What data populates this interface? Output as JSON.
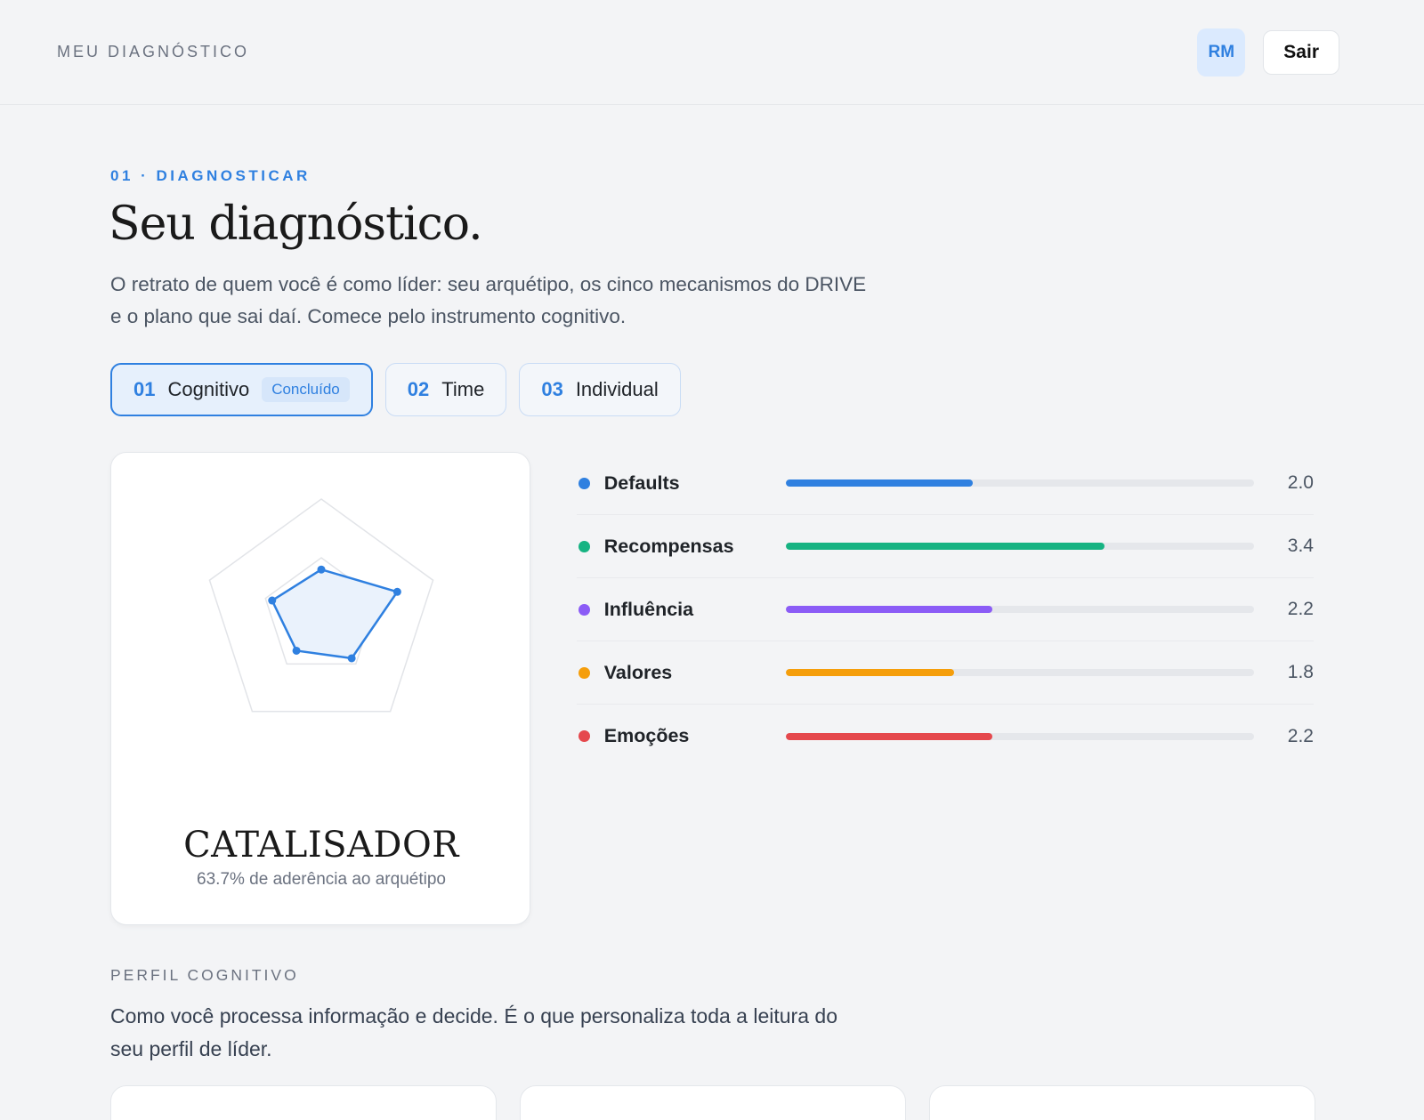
{
  "header": {
    "brand": "MEU DIAGNÓSTICO",
    "avatar_initials": "RM",
    "logout_label": "Sair"
  },
  "hero": {
    "eyebrow": "01 · DIAGNOSTICAR",
    "title": "Seu diagnóstico.",
    "intro": "O retrato de quem você é como líder: seu arquétipo, os cinco mecanismos do DRIVE e o plano que sai daí. Comece pelo instrumento cognitivo."
  },
  "tabs": [
    {
      "num": "01",
      "label": "Cognitivo",
      "badge": "Concluído",
      "active": true
    },
    {
      "num": "02",
      "label": "Time"
    },
    {
      "num": "03",
      "label": "Individual"
    }
  ],
  "archetype": {
    "name": "CATALISADOR",
    "adherence": "63.7% de aderência ao arquétipo"
  },
  "metrics_max": 5,
  "metrics": [
    {
      "label": "Defaults",
      "value": 2.0,
      "display": "2.0",
      "color": "#2f80e0"
    },
    {
      "label": "Recompensas",
      "value": 3.4,
      "display": "3.4",
      "color": "#16b382"
    },
    {
      "label": "Influência",
      "value": 2.2,
      "display": "2.2",
      "color": "#8b5cf6"
    },
    {
      "label": "Valores",
      "value": 1.8,
      "display": "1.8",
      "color": "#f59e0b"
    },
    {
      "label": "Emoções",
      "value": 2.2,
      "display": "2.2",
      "color": "#e5484d"
    }
  ],
  "profile": {
    "label": "PERFIL COGNITIVO",
    "text": "Como você processa informação e decide. É o que personaliza toda a leitura do seu perfil de líder."
  },
  "colors": {
    "accent": "#2f80e0",
    "radar_fill": "#eaf2fc"
  }
}
